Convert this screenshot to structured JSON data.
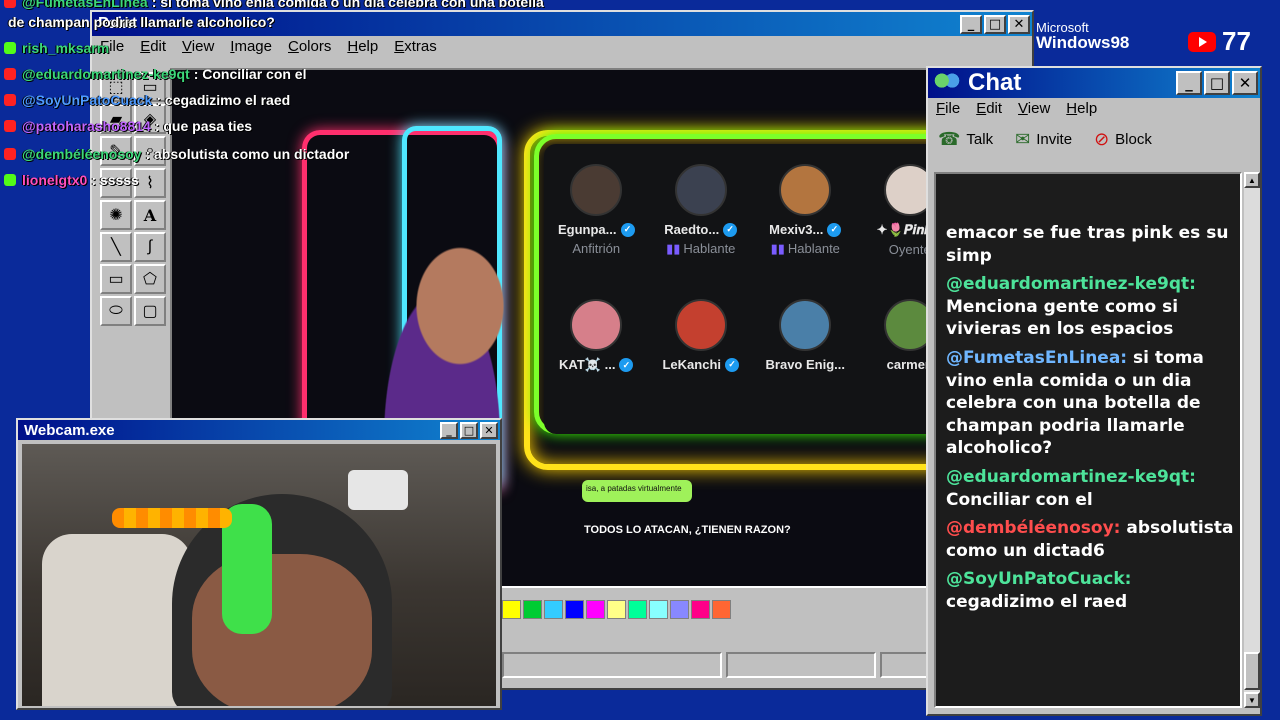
{
  "colors": {
    "desktop": "#0a2a9a",
    "titlebar": "#000f8a",
    "chat_green": "#4de39a",
    "chat_blue": "#6fb6ff",
    "chat_red": "#ff4d4d"
  },
  "bg_chat": [
    {
      "user": "@FumetasEnLinea",
      "text": ": si toma vino enla comida o un dia celebra con una botella",
      "color": "#3cd87a",
      "icon": "youtube-icon"
    },
    {
      "user": "",
      "text": "de champan podria llamarle alcoholico?",
      "color": "#ffffff",
      "icon": ""
    },
    {
      "user": "rish_mksarm",
      "text": "",
      "color": "#3cd87a",
      "icon": "kick-icon"
    },
    {
      "user": "@eduardomartinez-ke9qt",
      "text": ": Conciliar con el",
      "color": "#3cd87a",
      "icon": "youtube-icon"
    },
    {
      "user": "@SoyUnPatoCuack",
      "text": ": cegadizimo el raed",
      "color": "#4e9bff",
      "icon": "youtube-icon"
    },
    {
      "user": "@patoharasho8814",
      "text": ": que pasa ties",
      "color": "#c066ff",
      "icon": "youtube-icon"
    },
    {
      "user": "@dembéléenosoy",
      "text": ": absolutista como un dictador",
      "color": "#3cd87a",
      "icon": "youtube-icon"
    },
    {
      "user": "lionelgtx0",
      "text": ": sssss",
      "color": "#ff4fbf",
      "icon": "kick-icon"
    }
  ],
  "paint": {
    "title": "Paint",
    "menu": [
      "File",
      "Edit",
      "View",
      "Image",
      "Colors",
      "Help",
      "Extras"
    ],
    "caption": "TODOS LO ATACAN, ¿TIENEN RAZON?",
    "bubble_text": "isa, a patadas virtualmente",
    "palette": [
      "#ffff00",
      "#00cc33",
      "#33ccff",
      "#0000ff",
      "#ff00ff",
      "#ffff88",
      "#00ff99",
      "#88ffff",
      "#8888ff",
      "#ff0088",
      "#ff6633"
    ]
  },
  "spaces": {
    "members": [
      {
        "name": "Egunpa...",
        "role": "Anfitrión",
        "verified": true,
        "speaking": false,
        "avatar": "#4a3b33"
      },
      {
        "name": "Raedto...",
        "role": "Hablante",
        "verified": true,
        "speaking": true,
        "avatar": "#3b4150"
      },
      {
        "name": "Mexiv3...",
        "role": "Hablante",
        "verified": true,
        "speaking": true,
        "avatar": "#b3753f"
      },
      {
        "name": "✦🌷𝑷𝒊𝒏𝒌...",
        "role": "Oyente",
        "verified": false,
        "speaking": false,
        "avatar": "#ddd0c8"
      },
      {
        "name": "KAT☠️ ...",
        "role": "",
        "verified": true,
        "speaking": false,
        "avatar": "#d67f8a"
      },
      {
        "name": "LeKanchi",
        "role": "",
        "verified": true,
        "speaking": false,
        "avatar": "#c4402f"
      },
      {
        "name": "Bravo Enig...",
        "role": "",
        "verified": false,
        "speaking": false,
        "avatar": "#4a7fa8"
      },
      {
        "name": "carmen",
        "role": "",
        "verified": false,
        "speaking": false,
        "avatar": "#5c8a3e"
      }
    ]
  },
  "webcam": {
    "title": "Webcam.exe"
  },
  "chat": {
    "title": "Chat",
    "menu": [
      "File",
      "Edit",
      "View",
      "Help"
    ],
    "toolbar": {
      "talk": "Talk",
      "invite": "Invite",
      "block": "Block"
    },
    "messages": [
      {
        "user": "",
        "text": "emacor se fue tras pink es su simp",
        "color": "#4de39a"
      },
      {
        "user": "@eduardomartinez-ke9qt:",
        "text": "Menciona gente como si vivieras en los espacios",
        "color": "#4de39a"
      },
      {
        "user": "@FumetasEnLinea:",
        "text": "si toma vino enla comida o un dia celebra con una botella de champan podria llamarle alcoholico?",
        "color": "#6fb6ff"
      },
      {
        "user": "@eduardomartinez-ke9qt:",
        "text": "Conciliar con el",
        "color": "#4de39a"
      },
      {
        "user": "@dembéléenosoy:",
        "text": "absolutista como un dictad6",
        "color": "#ff4d4d"
      },
      {
        "user": "@SoyUnPatoCuack:",
        "text": "cegadizimo el raed",
        "color": "#4de39a"
      }
    ]
  },
  "overlay": {
    "ms_line1": "Microsoft",
    "ms_line2": "Windows98",
    "youtube_count": "77"
  }
}
